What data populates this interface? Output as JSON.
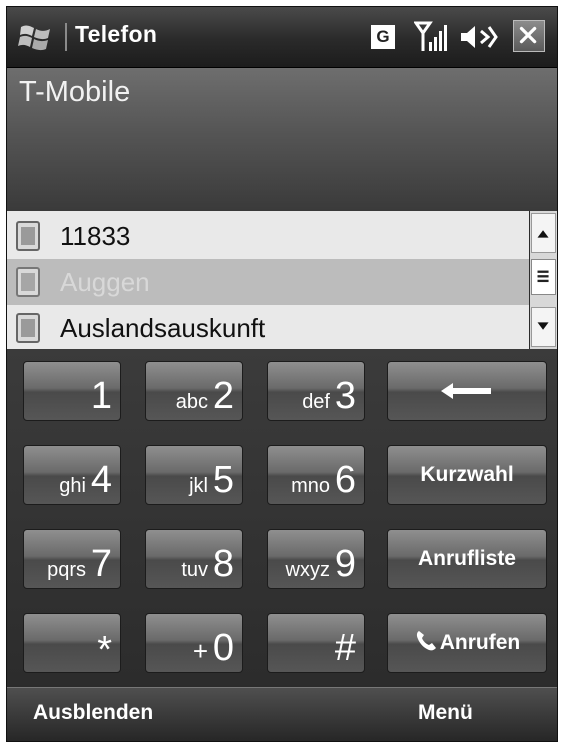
{
  "title_bar": {
    "app_title": "Telefon",
    "network_badge": "G",
    "icons": [
      "windows-start-icon",
      "signal-icon",
      "volume-icon",
      "close-icon"
    ]
  },
  "carrier": {
    "name": "T-Mobile"
  },
  "suggestions": [
    {
      "label": "11833",
      "selected": false
    },
    {
      "label": "Auggen",
      "selected": true
    },
    {
      "label": "Auslandsauskunft",
      "selected": false
    }
  ],
  "keypad": {
    "keys": [
      {
        "digit": "1",
        "letters": ""
      },
      {
        "digit": "2",
        "letters": "abc"
      },
      {
        "digit": "3",
        "letters": "def"
      },
      {
        "digit": "4",
        "letters": "ghi"
      },
      {
        "digit": "5",
        "letters": "jkl"
      },
      {
        "digit": "6",
        "letters": "mno"
      },
      {
        "digit": "7",
        "letters": "pqrs"
      },
      {
        "digit": "8",
        "letters": "tuv"
      },
      {
        "digit": "9",
        "letters": "wxyz"
      },
      {
        "digit": "*",
        "letters": ""
      },
      {
        "digit": "0",
        "letters": "+"
      },
      {
        "digit": "#",
        "letters": ""
      }
    ],
    "backspace_icon": "backspace-arrow-icon",
    "speed_dial_label": "Kurzwahl",
    "call_log_label": "Anrufliste",
    "call_label": "Anrufen"
  },
  "softkeys": {
    "left": "Ausblenden",
    "right": "Menü"
  },
  "colors": {
    "background": "#2b2b2b",
    "selected_row": "#bcbcbc",
    "list_bg": "#e9e9e9"
  }
}
